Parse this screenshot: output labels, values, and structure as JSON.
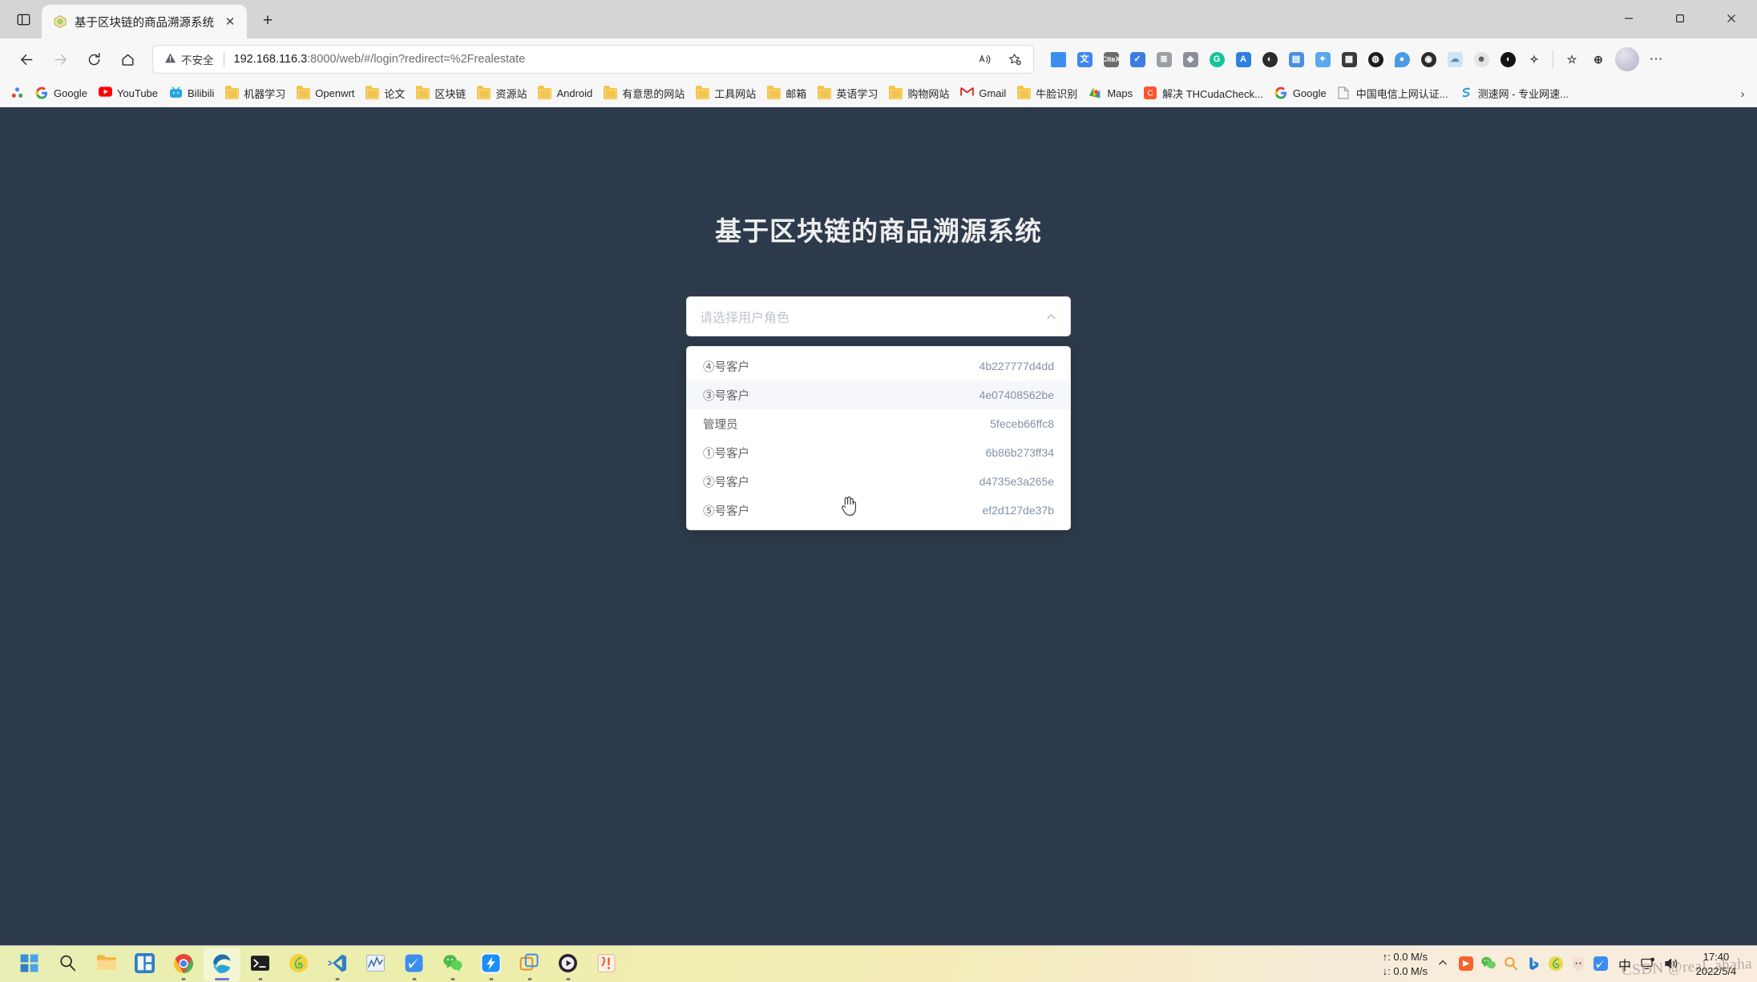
{
  "browser": {
    "tab": {
      "title": "基于区块链的商品溯源系统",
      "favicon_name": "site-favicon",
      "close_glyph": "✕"
    },
    "new_tab_glyph": "+",
    "window_controls": {
      "minimize": "—",
      "maximize": "❐",
      "close": "✕"
    },
    "nav": {
      "back_glyph": "←",
      "forward_glyph": "→",
      "reload_glyph": "⟳",
      "home_glyph": "⌂"
    },
    "omnibox": {
      "warning_icon": "warning-triangle-icon",
      "warning_text": "不安全",
      "url_host": "192.168.116.3",
      "url_rest": ":8000/web/#/login?redirect=%2Frealestate",
      "read_aloud_icon": "read-aloud-icon",
      "favorite_icon": "add-favorite-icon"
    },
    "toolbar_more_glyph": "⋯",
    "bookmarks": [
      {
        "label": "Google",
        "icon": "google-icon",
        "color": "#4285f4"
      },
      {
        "label": "YouTube",
        "icon": "youtube-icon",
        "color": "#ff0000"
      },
      {
        "label": "Bilibili",
        "icon": "bilibili-icon",
        "color": "#00a1d6"
      },
      {
        "label": "机器学习",
        "icon": "folder-icon",
        "color": "#f3c44b"
      },
      {
        "label": "Openwrt",
        "icon": "folder-icon",
        "color": "#f3c44b"
      },
      {
        "label": "论文",
        "icon": "folder-icon",
        "color": "#f3c44b"
      },
      {
        "label": "区块链",
        "icon": "folder-icon",
        "color": "#f3c44b"
      },
      {
        "label": "资源站",
        "icon": "folder-icon",
        "color": "#f3c44b"
      },
      {
        "label": "Android",
        "icon": "folder-icon",
        "color": "#f3c44b"
      },
      {
        "label": "有意思的网站",
        "icon": "folder-icon",
        "color": "#f3c44b"
      },
      {
        "label": "工具网站",
        "icon": "folder-icon",
        "color": "#f3c44b"
      },
      {
        "label": "邮箱",
        "icon": "folder-icon",
        "color": "#f3c44b"
      },
      {
        "label": "英语学习",
        "icon": "folder-icon",
        "color": "#f3c44b"
      },
      {
        "label": "购物网站",
        "icon": "folder-icon",
        "color": "#f3c44b"
      },
      {
        "label": "Gmail",
        "icon": "gmail-icon",
        "color": "#d93025"
      },
      {
        "label": "牛脸识别",
        "icon": "folder-icon",
        "color": "#f3c44b"
      },
      {
        "label": "Maps",
        "icon": "maps-icon",
        "color": "#34a853"
      },
      {
        "label": "解决 THCudaCheck...",
        "icon": "csdn-icon",
        "color": "#fc5531"
      },
      {
        "label": "Google",
        "icon": "google-icon",
        "color": "#4285f4"
      },
      {
        "label": "中国电信上网认证...",
        "icon": "page-icon",
        "color": "#9aa0a6"
      },
      {
        "label": "测速网 - 专业网速...",
        "icon": "speedtest-icon",
        "color": "#1a9ae0"
      }
    ],
    "bookmarks_overflow_glyph": "›"
  },
  "page": {
    "title": "基于区块链的商品溯源系统",
    "background_color": "#2d3a4b",
    "select": {
      "placeholder": "请选择用户角色",
      "value": "",
      "chevron_icon": "chevron-up-icon",
      "expanded": true
    },
    "dropdown_options": [
      {
        "label": "④号客户",
        "hash": "4b227777d4dd",
        "hovered": false
      },
      {
        "label": "③号客户",
        "hash": "4e07408562be",
        "hovered": true
      },
      {
        "label": "管理员",
        "hash": "5feceb66ffc8",
        "hovered": false
      },
      {
        "label": "①号客户",
        "hash": "6b86b273ff34",
        "hovered": false
      },
      {
        "label": "②号客户",
        "hash": "d4735e3a265e",
        "hovered": false
      },
      {
        "label": "⑤号客户",
        "hash": "ef2d127de37b",
        "hovered": false
      }
    ]
  },
  "taskbar": {
    "items": [
      {
        "name": "start-button",
        "icon": "windows-logo-icon"
      },
      {
        "name": "search-button",
        "icon": "search-icon"
      },
      {
        "name": "file-explorer",
        "icon": "folder-icon"
      },
      {
        "name": "widgets",
        "icon": "widgets-icon"
      },
      {
        "name": "google-chrome",
        "icon": "chrome-icon"
      },
      {
        "name": "microsoft-edge",
        "icon": "edge-icon"
      },
      {
        "name": "terminal",
        "icon": "terminal-icon"
      },
      {
        "name": "netease-music",
        "icon": "netease-music-icon"
      },
      {
        "name": "vs-code",
        "icon": "vscode-icon"
      },
      {
        "name": "task-manager",
        "icon": "chart-icon"
      },
      {
        "name": "foxmail",
        "icon": "foxmail-icon"
      },
      {
        "name": "wechat",
        "icon": "wechat-icon"
      },
      {
        "name": "dingtalk",
        "icon": "dingtalk-icon"
      },
      {
        "name": "remote-desktop",
        "icon": "remote-desktop-icon"
      },
      {
        "name": "media-player",
        "icon": "play-icon"
      },
      {
        "name": "wps-office",
        "icon": "wps-icon"
      }
    ],
    "network": {
      "upload": "↑: 0.0 M/s",
      "download": "↓: 0.0 M/s"
    },
    "tray_expand_glyph": "⌃",
    "tray": [
      {
        "name": "xunlei-tray-icon",
        "color": "#f5642d"
      },
      {
        "name": "wechat-tray-icon",
        "color": "#4dbb4a"
      },
      {
        "name": "everything-tray-icon",
        "color": "#e8a33d"
      },
      {
        "name": "bing-tray-icon",
        "color": "#1c7fd6"
      },
      {
        "name": "netease-tray-icon",
        "color": "#e8d84a"
      },
      {
        "name": "tim-tray-icon",
        "color": "#e8b8a0"
      },
      {
        "name": "foxmail-tray-icon",
        "color": "#3b8ef0"
      }
    ],
    "ime_label": "中",
    "network_icon": "network-monitor-icon",
    "volume_icon": "volume-icon",
    "clock_time": "17:40",
    "clock_date": "2022/5/4",
    "watermark": "CSDN @real_ahaha"
  }
}
